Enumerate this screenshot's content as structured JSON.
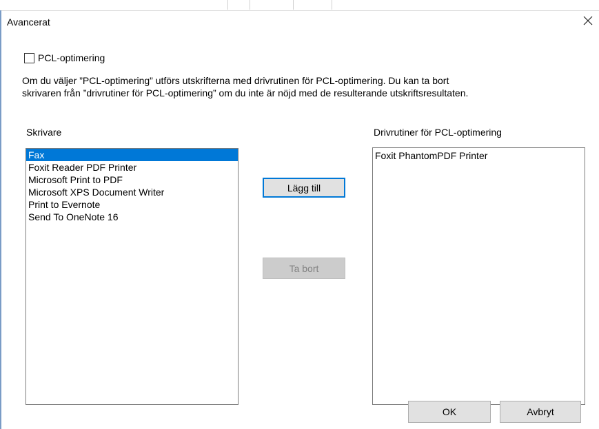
{
  "dialog": {
    "title": "Avancerat",
    "close_icon": "close-icon"
  },
  "checkbox": {
    "label": "PCL-optimering",
    "checked": false
  },
  "description": {
    "line1": "Om du väljer ”PCL-optimering” utförs utskrifterna med drivrutinen för PCL-optimering. Du kan ta bort",
    "line2": "skrivaren från ”drivrutiner för PCL-optimering” om du inte är nöjd med de resulterande utskriftsresultaten."
  },
  "printers": {
    "label": "Skrivare",
    "items": [
      "Fax",
      "Foxit Reader PDF Printer",
      "Microsoft Print to PDF",
      "Microsoft XPS Document Writer",
      "Print to Evernote",
      "Send To OneNote 16"
    ],
    "selected": "Fax"
  },
  "pcl_drivers": {
    "label": "Drivrutiner för PCL-optimering",
    "items": [
      "Foxit PhantomPDF Printer"
    ]
  },
  "buttons": {
    "add": "Lägg till",
    "remove": "Ta bort",
    "ok": "OK",
    "cancel": "Avbryt"
  },
  "colors": {
    "selection": "#0078d7",
    "focus_border": "#0078d7"
  }
}
